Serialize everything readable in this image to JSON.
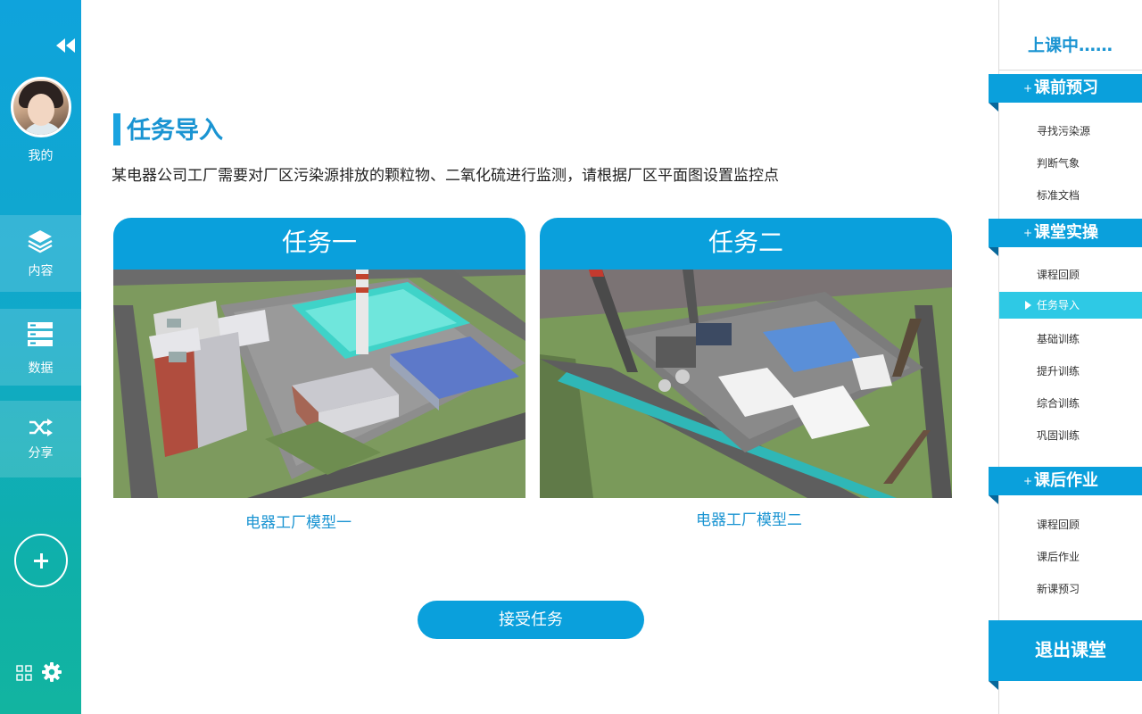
{
  "sidebar": {
    "my_label": "我的",
    "nav": [
      {
        "label": "内容",
        "icon": "layers-icon"
      },
      {
        "label": "数据",
        "icon": "database-icon"
      },
      {
        "label": "分享",
        "icon": "shuffle-share-icon"
      }
    ],
    "bottom_icons": [
      "grid-icon",
      "gear-icon"
    ]
  },
  "main": {
    "title": "任务导入",
    "description": "某电器公司工厂需要对厂区污染源排放的颗粒物、二氧化硫进行监测，请根据厂区平面图设置监控点",
    "cards": [
      {
        "header": "任务一",
        "caption": "电器工厂模型一"
      },
      {
        "header": "任务二",
        "caption": "电器工厂模型二"
      }
    ],
    "accept_button": "接受任务"
  },
  "right_panel": {
    "status": "上课中……",
    "sections": [
      {
        "plus": "+",
        "title": "课前预习",
        "items": [
          "寻找污染源",
          "判断气象",
          "标准文档"
        ]
      },
      {
        "plus": "+",
        "title": "课堂实操",
        "items": [
          "课程回顾",
          "任务导入",
          "基础训练",
          "提升训练",
          "综合训练",
          "巩固训练"
        ]
      },
      {
        "plus": "+",
        "title": "课后作业",
        "items": [
          "课程回顾",
          "课后作业",
          "新课预习"
        ]
      }
    ],
    "active_item": "任务导入",
    "exit_button": "退出课堂"
  },
  "colors": {
    "accent": "#0aa0dc",
    "title_blue": "#1a94d2",
    "active_item": "#2ec9e5",
    "sidebar_top": "#0fa3dc",
    "sidebar_bottom": "#12b4a0"
  }
}
